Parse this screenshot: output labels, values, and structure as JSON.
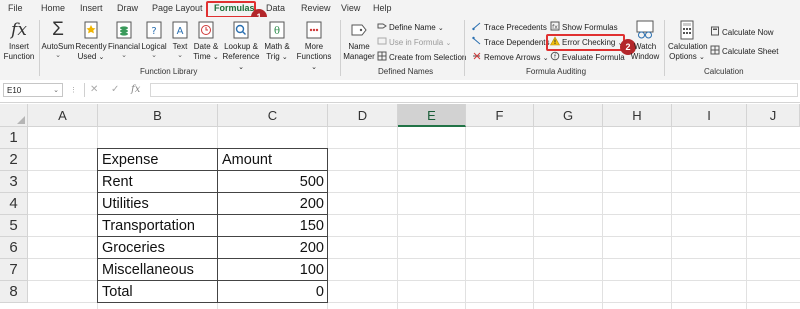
{
  "tabs": [
    "File",
    "Home",
    "Insert",
    "Draw",
    "Page Layout",
    "Formulas",
    "Data",
    "Review",
    "View",
    "Help"
  ],
  "active_tab": "Formulas",
  "callouts": {
    "one": "1",
    "two": "2"
  },
  "ribbon": {
    "insert_function": {
      "line1": "Insert",
      "line2": "Function"
    },
    "autosum": {
      "label": "AutoSum"
    },
    "recently_used": {
      "line1": "Recently",
      "line2": "Used"
    },
    "financial": {
      "label": "Financial"
    },
    "logical": {
      "label": "Logical"
    },
    "text": {
      "label": "Text"
    },
    "date_time": {
      "line1": "Date &",
      "line2": "Time"
    },
    "lookup_reference": {
      "line1": "Lookup &",
      "line2": "Reference"
    },
    "math_trig": {
      "line1": "Math &",
      "line2": "Trig"
    },
    "more_functions": {
      "line1": "More",
      "line2": "Functions"
    },
    "name_manager": {
      "line1": "Name",
      "line2": "Manager"
    },
    "define_name": "Define Name",
    "use_in_formula": "Use in Formula",
    "create_from_selection": "Create from Selection",
    "trace_precedents": "Trace Precedents",
    "trace_dependents": "Trace Dependents",
    "remove_arrows": "Remove Arrows",
    "show_formulas": "Show Formulas",
    "error_checking": "Error Checking",
    "evaluate_formula": "Evaluate Formula",
    "watch_window": {
      "line1": "Watch",
      "line2": "Window"
    },
    "calculation_options": {
      "line1": "Calculation",
      "line2": "Options"
    },
    "calculate_now": "Calculate Now",
    "calculate_sheet": "Calculate Sheet",
    "groups": {
      "function_library": "Function Library",
      "defined_names": "Defined Names",
      "formula_auditing": "Formula Auditing",
      "calculation": "Calculation"
    }
  },
  "formula_bar": {
    "name_box": "E10",
    "fx": "fx",
    "formula": ""
  },
  "columns": [
    "A",
    "B",
    "C",
    "D",
    "E",
    "F",
    "G",
    "H",
    "I",
    "J"
  ],
  "selected_column": "E",
  "rows": [
    "1",
    "2",
    "3",
    "4",
    "5",
    "6",
    "7",
    "8"
  ],
  "table": {
    "header": {
      "expense": "Expense",
      "amount": "Amount"
    },
    "rows": [
      {
        "expense": "Rent",
        "amount": "500"
      },
      {
        "expense": "Utilities",
        "amount": "200"
      },
      {
        "expense": "Transportation",
        "amount": "150"
      },
      {
        "expense": "Groceries",
        "amount": "200"
      },
      {
        "expense": "Miscellaneous",
        "amount": "100"
      },
      {
        "expense": "Total",
        "amount": "0"
      }
    ]
  },
  "colors": {
    "excel_green": "#217346",
    "highlight_red": "#e03030",
    "badge_red": "#b3262a"
  }
}
